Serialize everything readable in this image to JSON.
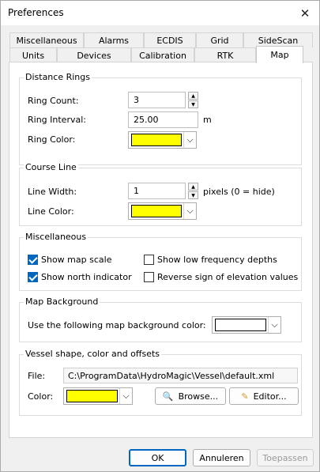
{
  "window": {
    "title": "Preferences"
  },
  "tabs_row1": [
    "Miscellaneous",
    "Alarms",
    "ECDIS",
    "Grid",
    "SideScan"
  ],
  "tabs_row2": [
    "Units",
    "Devices",
    "Calibration",
    "RTK",
    "Map"
  ],
  "active_tab": "Map",
  "distance_rings": {
    "title": "Distance Rings",
    "ring_count_label": "Ring Count:",
    "ring_count_value": "3",
    "ring_interval_label": "Ring Interval:",
    "ring_interval_value": "25.00",
    "ring_interval_unit": "m",
    "ring_color_label": "Ring Color:",
    "ring_color": "#ffff00"
  },
  "course_line": {
    "title": "Course Line",
    "line_width_label": "Line Width:",
    "line_width_value": "1",
    "line_width_hint": "pixels (0 = hide)",
    "line_color_label": "Line Color:",
    "line_color": "#ffff00"
  },
  "miscellaneous": {
    "title": "Miscellaneous",
    "show_map_scale": {
      "label": "Show map scale",
      "checked": true
    },
    "show_north_indicator": {
      "label": "Show north indicator",
      "checked": true
    },
    "show_low_freq": {
      "label": "Show low frequency depths",
      "checked": false
    },
    "reverse_sign": {
      "label": "Reverse sign of elevation values",
      "checked": false
    }
  },
  "map_background": {
    "title": "Map Background",
    "label": "Use the following map background color:",
    "color": "#ffffff"
  },
  "vessel": {
    "title": "Vessel shape, color and offsets",
    "file_label": "File:",
    "file_value": "C:\\ProgramData\\HydroMagic\\Vessel\\default.xml",
    "color_label": "Color:",
    "color": "#ffff00",
    "browse_label": "Browse...",
    "editor_label": "Editor..."
  },
  "buttons": {
    "ok": "OK",
    "cancel": "Annuleren",
    "apply": "Toepassen"
  }
}
